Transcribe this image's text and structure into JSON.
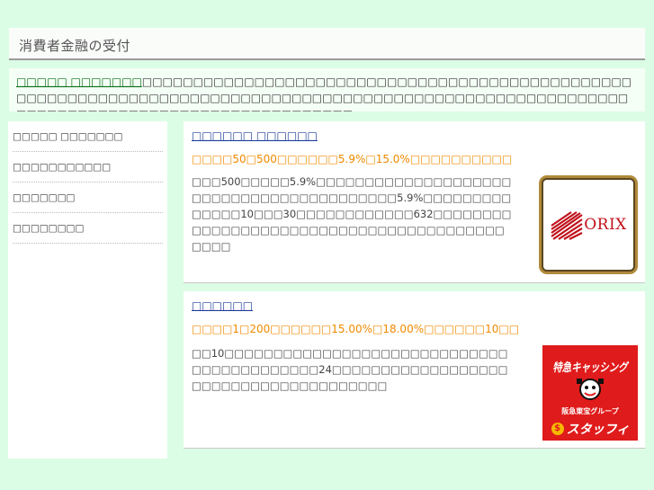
{
  "header": {
    "title": "消費者金融の受付"
  },
  "intro": {
    "lead": "□□□□□ □□□□□□□",
    "text": "□□□□□□□□□□□□□□□□□□□□□□□□□□□□□□□□□□□□□□□□□□□□□□□□□□□□□□□□□□□□□□□□□□□□□□□□□□□□□□□□□□□□□□□□□□□□□□□□□□□□□□□□□□□□□□□□□□□□□□□□□□□□□□□□□□□□□□□□□□□□□"
  },
  "sidebar": {
    "items": [
      {
        "label": "□□□□□ □□□□□□□"
      },
      {
        "label": "□□□□□□□□□□□"
      },
      {
        "label": "□□□□□□□"
      },
      {
        "label": "□□□□□□□□"
      }
    ]
  },
  "cards": [
    {
      "title": "□□□□□□ □□□□□□",
      "subtitle": "□□□□50□500□□□□□□5.9%□15.0%□□□□□□□□□□",
      "description": "□□□500□□□□□5.9%□□□□□□□□□□□□□□□□□□□□□□□□□□□□□□□□□□□□□□□□□5.9%□□□□□□□□□□□□□□10□□□30□□□□□□□□□□□□632□□□□□□□□□□□□□□□□□□□□□□□□□□□□□□□□□□□□□□□□□□□□",
      "logo_text": "ORIX"
    },
    {
      "title": "□□□□□□",
      "subtitle": "□□□□1□200□□□□□□15.00%□18.00%□□□□□□10□□",
      "description": "□□10□□□□□□□□□□□□□□□□□□□□□□□□□□□□□□□□□□□□□□□□□□24□□□□□□□□□□□□□□□□□□□□□□□□□□□□□□□□□□□□□□",
      "logo_lines": [
        "特急キャッシング",
        "阪急東宝グループ",
        "スタッフィ"
      ]
    }
  ],
  "colors": {
    "background": "#dcfde5",
    "link": "#1d3c9a",
    "highlight": "#f08a00",
    "lead": "#0a6b14"
  }
}
